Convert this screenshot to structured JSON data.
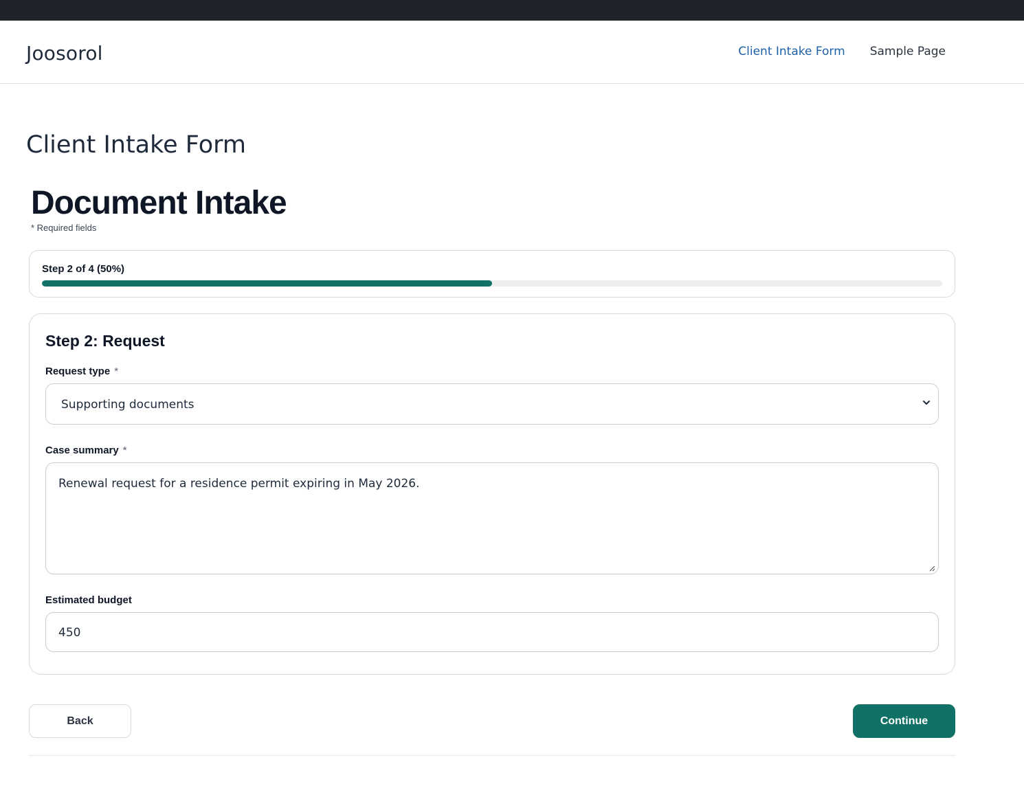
{
  "site": {
    "title": "Joosorol",
    "nav": [
      {
        "label": "Client Intake Form",
        "active": true
      },
      {
        "label": "Sample Page",
        "active": false
      }
    ]
  },
  "page": {
    "title": "Client Intake Form"
  },
  "form": {
    "title": "Document Intake",
    "required_note": "* Required fields",
    "progress": {
      "label": "Step 2 of 4 (50%)",
      "current_step": 2,
      "total_steps": 4,
      "percent": 50
    },
    "step": {
      "heading": "Step 2: Request",
      "fields": {
        "request_type": {
          "label": "Request type",
          "required_mark": "*",
          "value": "Supporting documents"
        },
        "case_summary": {
          "label": "Case summary",
          "required_mark": "*",
          "value": "Renewal request for a residence permit expiring in May 2026."
        },
        "estimated_budget": {
          "label": "Estimated budget",
          "value": "450"
        }
      }
    },
    "buttons": {
      "back": "Back",
      "continue": "Continue"
    }
  },
  "colors": {
    "topbar": "#1e2329",
    "accent": "#117166",
    "nav_active": "#1f5fa6",
    "progress_track": "#eeeeee"
  },
  "icons": {
    "select_chevron": "chevron-down-icon",
    "textarea_resize": "resize-handle-icon"
  }
}
